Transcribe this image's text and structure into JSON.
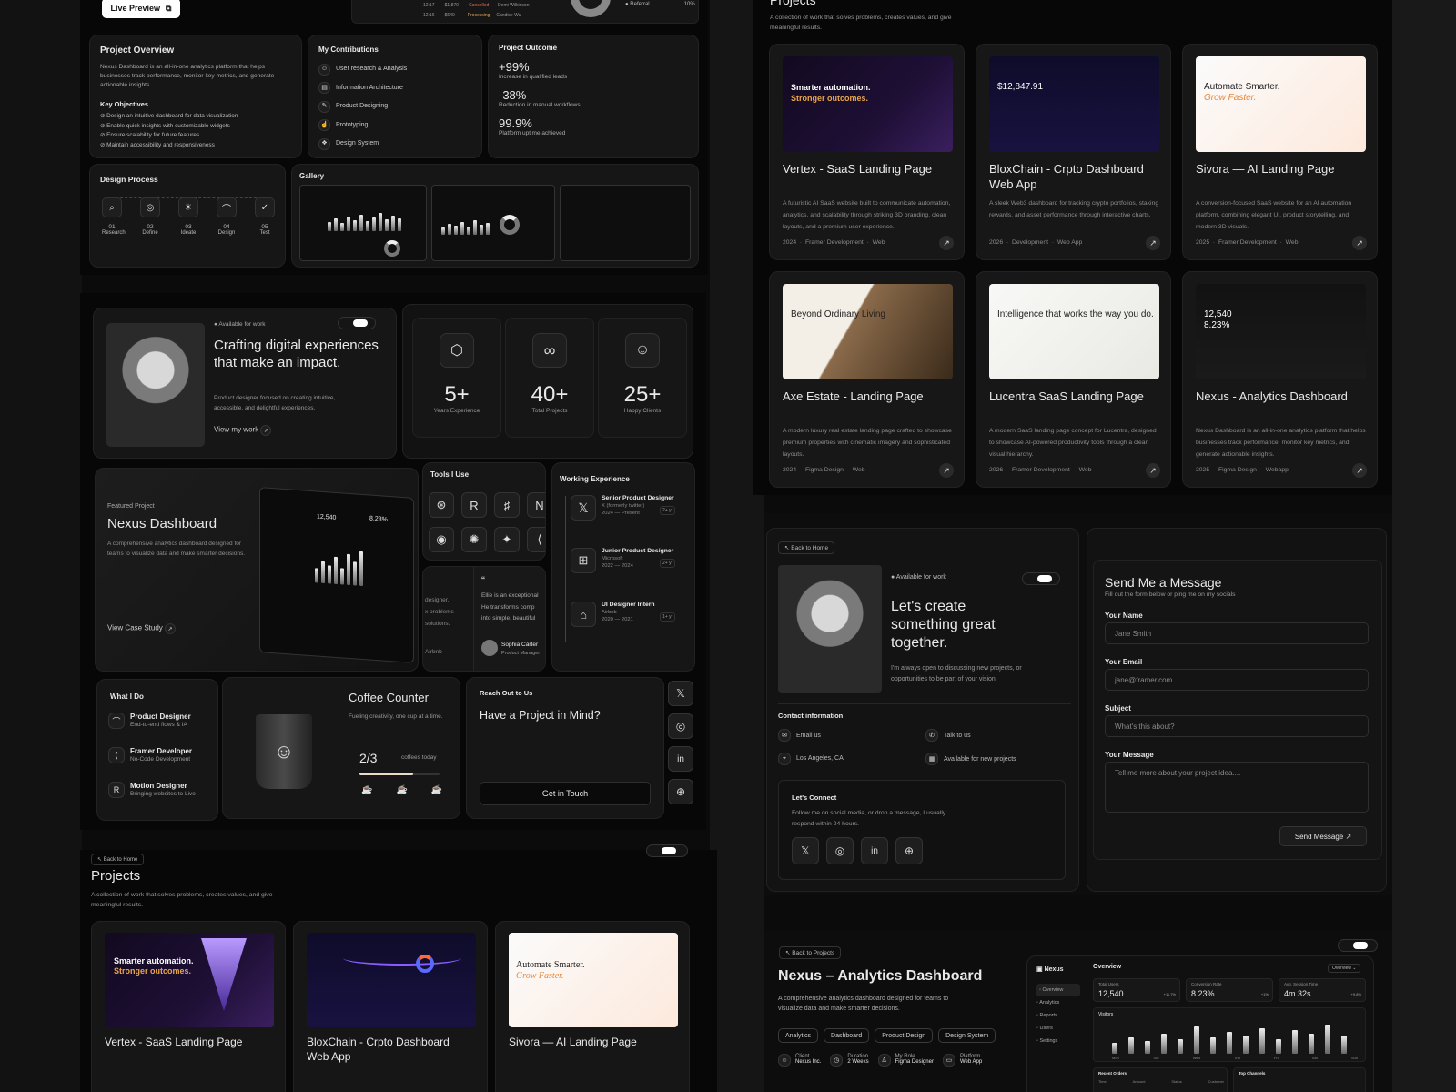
{
  "topleft": {
    "live_preview": "Live Preview",
    "mini_rows": [
      [
        "12:17",
        "$1,870",
        "Cancelled",
        "Demi Wilkinson"
      ],
      [
        "12:16",
        "$640",
        "Processing",
        "Candice Wu"
      ]
    ],
    "referral": "Referral",
    "referral_pct": "10%"
  },
  "overview": {
    "title": "Project Overview",
    "desc": "Nexus Dashboard is an all-in-one analytics platform that helps businesses track performance, monitor key metrics, and generate actionable insights.",
    "objectives_title": "Key Objectives",
    "objectives": [
      "Design an intuitive dashboard for data visualization",
      "Enable quick insights with customizable widgets",
      "Ensure scalability for future features",
      "Maintain accessibility and responsiveness"
    ]
  },
  "contrib": {
    "title": "My Contributions",
    "items": [
      "User research & Analysis",
      "Information Architecture",
      "Product Designing",
      "Prototyping",
      "Design System"
    ]
  },
  "outcome": {
    "title": "Project Outcome",
    "items": [
      {
        "v": "+99%",
        "l": "Increase in qualified leads"
      },
      {
        "v": "-38%",
        "l": "Reduction in manual workflows"
      },
      {
        "v": "99.9%",
        "l": "Platform uptime achieved"
      }
    ]
  },
  "process": {
    "title": "Design Process",
    "steps": [
      {
        "n": "01",
        "l": "Research"
      },
      {
        "n": "02",
        "l": "Define"
      },
      {
        "n": "03",
        "l": "Ideate"
      },
      {
        "n": "04",
        "l": "Design"
      },
      {
        "n": "05",
        "l": "Test"
      }
    ]
  },
  "gallery": {
    "title": "Gallery"
  },
  "hero": {
    "available": "Available for work",
    "title": "Crafting digital experiences that make an impact.",
    "desc": "Product designer focused on creating intuitive, accessible, and delightful experiences.",
    "cta": "View my work"
  },
  "stats": [
    {
      "v": "5+",
      "l": "Years Experience"
    },
    {
      "v": "40+",
      "l": "Total Projects"
    },
    {
      "v": "25+",
      "l": "Happy Clients"
    }
  ],
  "featured": {
    "kicker": "Featured Project",
    "title": "Nexus Dashboard",
    "desc": "A comprehensive analytics dashboard designed for teams to visualize data and make smarter decisions.",
    "cta": "View Case Study",
    "mini_value": "12,540",
    "mini_pct": "8.23%"
  },
  "tools": {
    "title": "Tools I Use"
  },
  "testimonial": {
    "left": [
      "designer.",
      "x problems",
      "solutions.",
      "Airbnb"
    ],
    "quote": "Ellie is an exceptional",
    "line2": "He transforms comp",
    "line3": "into simple, beautiful",
    "name": "Sophia Carter",
    "role": "Product Manager"
  },
  "work": {
    "title": "Working Experience",
    "items": [
      {
        "role": "Senior Product Designer",
        "co": "X (formerly twitter)",
        "years": "2024 — Present",
        "dur": "2+ yr"
      },
      {
        "role": "Junior Product Designer",
        "co": "Microsoft",
        "years": "2022 — 2024",
        "dur": "2+ yr"
      },
      {
        "role": "UI Designer Intern",
        "co": "Airbnb",
        "years": "2020 — 2021",
        "dur": "1+ yr"
      }
    ]
  },
  "whatido": {
    "title": "What I Do",
    "items": [
      {
        "t": "Product Designer",
        "s": "End-to-end flows & IA"
      },
      {
        "t": "Framer Developer",
        "s": "No-Code Development"
      },
      {
        "t": "Motion Designer",
        "s": "Bringing websites to Live"
      }
    ]
  },
  "coffee": {
    "title": "Coffee Counter",
    "desc": "Fueling creativity, one cup at a time.",
    "count": "2/3",
    "unit": "coffees today",
    "progress": 0.67
  },
  "reach": {
    "kicker": "Reach Out to Us",
    "title": "Have a Project in Mind?",
    "cta": "Get in Touch"
  },
  "projects_bottom": {
    "back": "Back to Home",
    "title": "Projects",
    "desc": "A collection of work that solves problems, creates values, and give meaningful results.",
    "items": [
      "Vertex - SaaS Landing Page",
      "BloxChain - Crpto Dashboard Web App",
      "Sivora — AI Landing Page"
    ]
  },
  "projects_right": {
    "title": "Projects",
    "desc": "A collection of work that solves problems, creates values, and give meaningful results.",
    "items": [
      {
        "name": "Vertex - SaaS Landing Page",
        "desc": "A futuristic AI SaaS website built to communicate automation, analytics, and scalability through striking 3D branding, clean layouts, and a premium user experience.",
        "year": "2024",
        "tag1": "Framer Development",
        "tag2": "Web",
        "thumb_a": "Smarter automation.",
        "thumb_b": "Stronger outcomes."
      },
      {
        "name": "BloxChain - Crpto Dashboard Web App",
        "desc": "A sleek Web3 dashboard for tracking crypto portfolios, staking rewards, and asset performance through interactive charts.",
        "year": "2026",
        "tag1": "Development",
        "tag2": "Web App",
        "thumb_a": "$12,847.91"
      },
      {
        "name": "Sivora — AI Landing Page",
        "desc": "A conversion-focused SaaS website for an AI automation platform, combining elegant UI, product storytelling, and modern 3D visuals.",
        "year": "2025",
        "tag1": "Framer Development",
        "tag2": "Web",
        "thumb_a": "Automate Smarter.",
        "thumb_b": "Grow Faster."
      },
      {
        "name": "Axe Estate - Landing Page",
        "desc": "A modern luxury real estate landing page crafted to showcase premium properties with cinematic imagery and sophisticated layouts.",
        "year": "2024",
        "tag1": "Figma Design",
        "tag2": "Web",
        "thumb_a": "Beyond Ordinary Living"
      },
      {
        "name": "Lucentra SaaS Landing Page",
        "desc": "A modern SaaS landing page concept for Lucentra, designed to showcase AI-powered productivity tools through a clean visual hierarchy.",
        "year": "2026",
        "tag1": "Framer Development",
        "tag2": "Web",
        "thumb_a": "Intelligence that works the way you do."
      },
      {
        "name": "Nexus - Analytics Dashboard",
        "desc": "Nexus Dashboard is an all-in-one analytics platform that helps businesses track performance, monitor key metrics, and generate actionable insights.",
        "year": "2025",
        "tag1": "Figma Design",
        "tag2": "Webapp",
        "thumb_a": "12,540",
        "thumb_b": "8.23%"
      }
    ]
  },
  "contact": {
    "back": "Back to Home",
    "available": "Available for work",
    "title": "Let's create something great together.",
    "desc": "I'm always open to discussing new projects, or opportunities to be part of your vision.",
    "info_title": "Contact information",
    "email": "Email us",
    "talk": "Talk to us",
    "location": "Los Angeles, CA",
    "avail": "Available for new projects",
    "connect_title": "Let's Connect",
    "connect_desc": "Follow me on social media, or drop a message, I usually respond within 24 hours."
  },
  "form": {
    "title": "Send Me a Message",
    "sub": "Fill out the form below or ping me on my socials",
    "name_label": "Your Name",
    "name_ph": "Jane Smith",
    "email_label": "Your Email",
    "email_ph": "jane@framer.com",
    "subject_label": "Subject",
    "subject_ph": "What's this about?",
    "msg_label": "Your Message",
    "msg_ph": "Tell me more about your project idea....",
    "submit": "Send Message"
  },
  "nexus": {
    "back": "Back to Projects",
    "title": "Nexus – Analytics Dashboard",
    "desc": "A comprehensive analytics dashboard designed for teams to visualize data and make smarter decisions.",
    "tags": [
      "Analytics",
      "Dashboard",
      "Product Design",
      "Design System"
    ],
    "meta": [
      {
        "k": "Client",
        "v": "Nexus Inc."
      },
      {
        "k": "Duration",
        "v": "2 Weeks"
      },
      {
        "k": "My Role",
        "v": "Figma Designer"
      },
      {
        "k": "Platform",
        "v": "Web App"
      }
    ],
    "app_name": "Nexus",
    "nav": [
      "Overview",
      "Analytics",
      "Reports",
      "Users",
      "Settings"
    ],
    "overview": "Overview",
    "dropdown": "Overview",
    "kpis": [
      {
        "k": "Total Users",
        "v": "12,540",
        "d": "+11.7%"
      },
      {
        "k": "Conversion Rate",
        "v": "8.23%",
        "d": "+1%"
      },
      {
        "k": "Avg. Session Time",
        "v": "4m 32s",
        "d": "+9.8%"
      }
    ],
    "visitors": "Visitors",
    "days": [
      "Mon",
      "Tue",
      "Wed",
      "Thu",
      "Fri",
      "Sat",
      "Sun"
    ],
    "recent": "Recent Orders",
    "cols": [
      "Time",
      "Amount",
      "Status",
      "Customer"
    ],
    "channels": "Top Channels"
  },
  "colors": {
    "bg": "#0b0b0c",
    "panel": "#070707",
    "card": "#161616",
    "accent_orange": "#e8873a",
    "accent_purple": "#7c4dff"
  }
}
